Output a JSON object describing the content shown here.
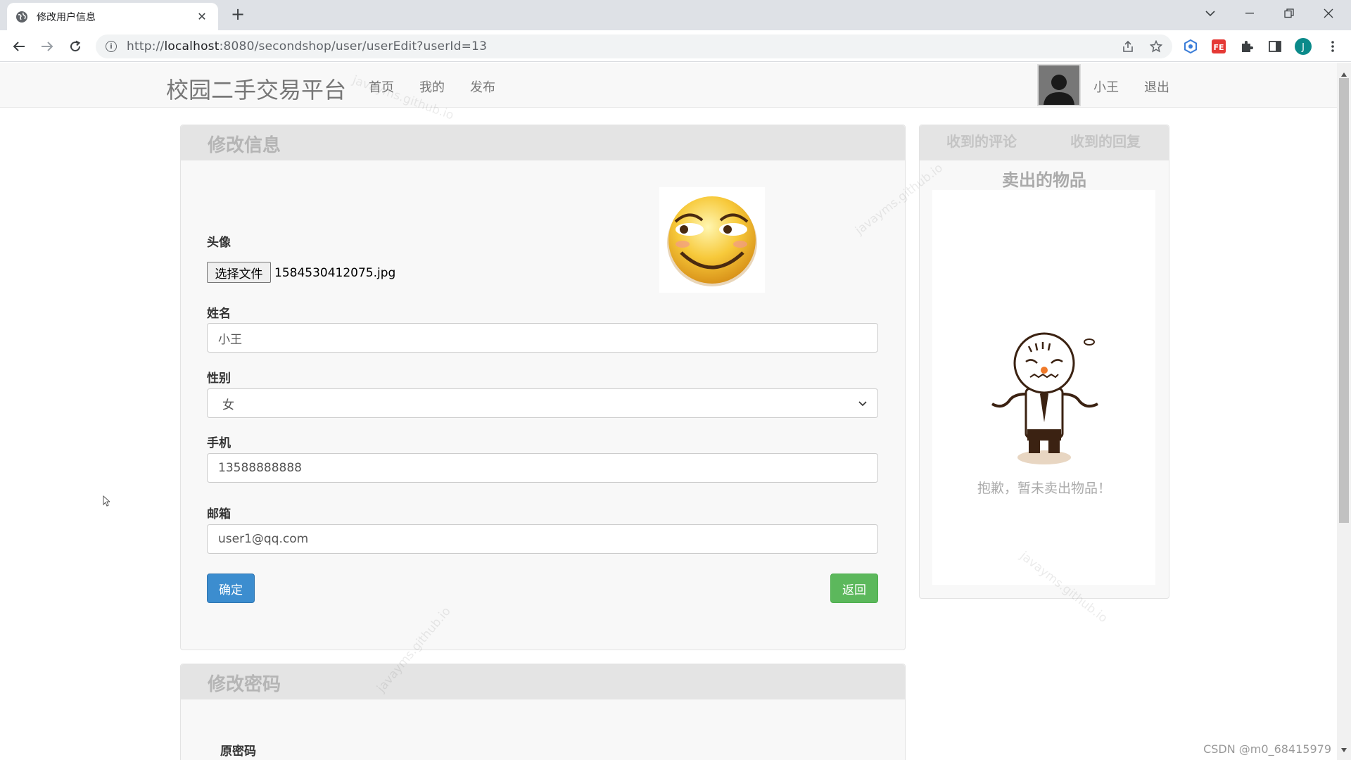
{
  "browser": {
    "tab_title": "修改用户信息",
    "url_prefix": "http://",
    "url_host": "localhost",
    "url_rest": ":8080/secondshop/user/userEdit?userId=13",
    "profile_initial": "J"
  },
  "navbar": {
    "brand": "校园二手交易平台",
    "links": [
      "首页",
      "我的",
      "发布"
    ],
    "username": "小王",
    "logout": "退出"
  },
  "edit_panel": {
    "title": "修改信息",
    "avatar_label": "头像",
    "file_button": "选择文件",
    "file_name": "1584530412075.jpg",
    "name_label": "姓名",
    "name_value": "小王",
    "gender_label": "性别",
    "gender_value": "女",
    "phone_label": "手机",
    "phone_value": "13588888888",
    "email_label": "邮箱",
    "email_value": "user1@qq.com",
    "confirm_button": "确定",
    "back_button": "返回"
  },
  "password_panel": {
    "title": "修改密码",
    "old_password_label": "原密码"
  },
  "side_panel": {
    "tabs": [
      "收到的评论",
      "收到的回复"
    ],
    "subtitle": "卖出的物品",
    "empty_text": "抱歉，暂未卖出物品！"
  },
  "watermark_text": "javayms.github.io",
  "footer_watermark": "CSDN @m0_68415979"
}
